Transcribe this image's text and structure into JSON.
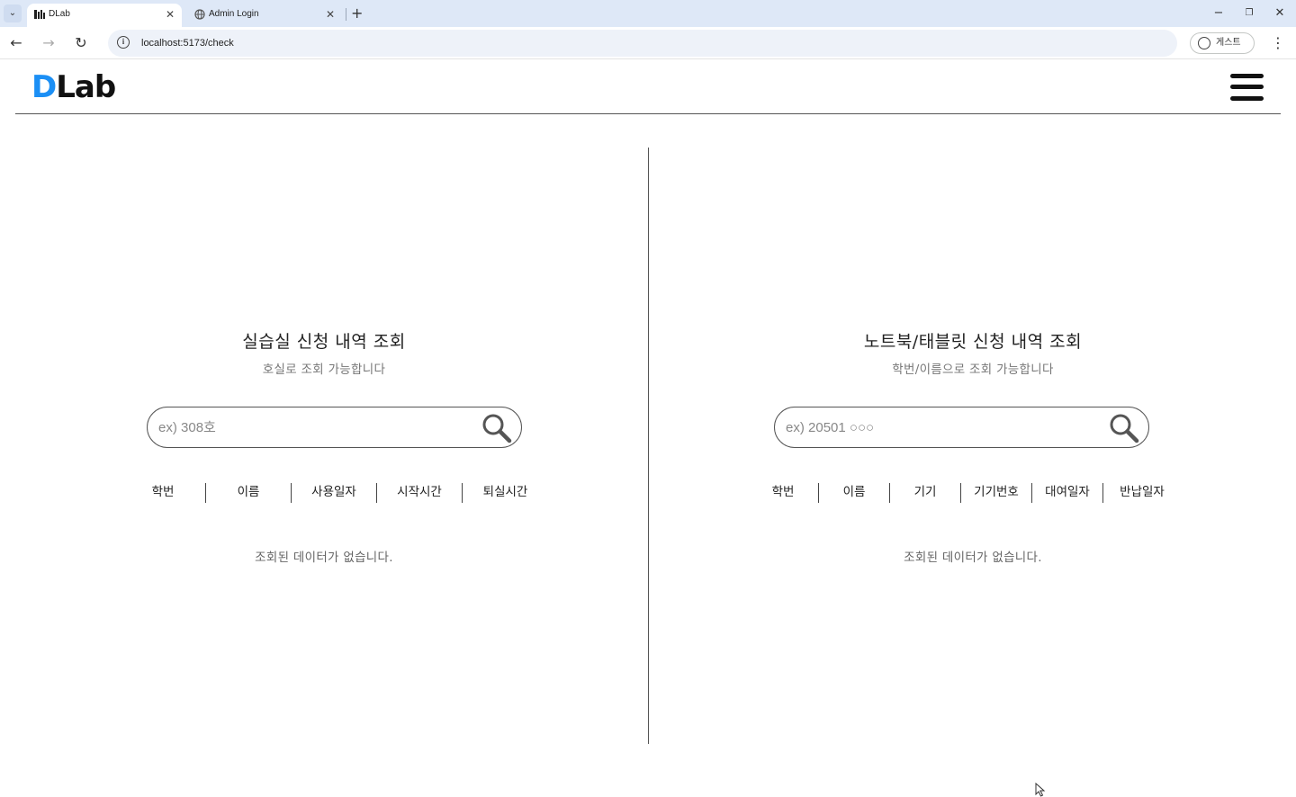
{
  "browser": {
    "tabs": [
      {
        "title": "DLab",
        "active": true
      },
      {
        "title": "Admin Login",
        "active": false
      }
    ],
    "url": "localhost:5173/check",
    "profile_label": "게스트",
    "icons": [
      "tab-search-icon",
      "close-icon",
      "new-tab-icon",
      "minimize-icon",
      "restore-icon",
      "window-close-icon",
      "back-icon",
      "forward-icon",
      "reload-icon",
      "site-info-icon",
      "profile-icon",
      "menu-kebab-icon"
    ]
  },
  "header": {
    "logo_d": "D",
    "logo_lab": "Lab",
    "logo_accent_color": "#1b8ff5",
    "menu_icon": "hamburger-icon"
  },
  "room_panel": {
    "title": "실습실 신청 내역 조회",
    "subtitle": "호실로 조회 가능합니다",
    "search_placeholder": "ex) 308호",
    "columns": [
      "학번",
      "이름",
      "사용일자",
      "시작시간",
      "퇴실시간"
    ],
    "empty_message": "조회된 데이터가 없습니다."
  },
  "device_panel": {
    "title": "노트북/태블릿 신청 내역 조회",
    "subtitle": "학번/이름으로 조회 가능합니다",
    "search_placeholder": "ex) 20501 ○○○",
    "columns": [
      "학번",
      "이름",
      "기기",
      "기기번호",
      "대여일자",
      "반납일자"
    ],
    "empty_message": "조회된 데이터가 없습니다."
  }
}
